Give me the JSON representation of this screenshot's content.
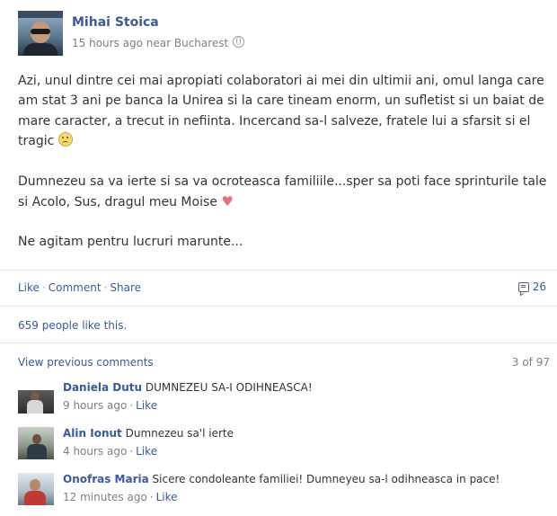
{
  "post": {
    "author": "Mihai Stoica",
    "timestamp": "15 hours ago near Bucharest",
    "privacy_icon": "globe-icon",
    "paragraphs": {
      "p1": "Azi, unul dintre cei mai apropiati colaboratori ai mei din ultimii ani, omul langa care am stat 3 ani pe banca la Unirea si la care tineam enorm, un sufletist si un baiat de mare caracter, a trecut in nefiinta. Incercand sa-l salveze, fratele lui a sfarsit si el tragic",
      "p2": "Dumnezeu sa va ierte si sa va ocroteasca familiile...sper sa poti face sprinturile tale si Acolo, Sus, dragul meu Moise",
      "p3": "Ne agitam pentru lucruri marunte..."
    },
    "emoji_sad": "sad-face-emoji",
    "emoji_heart": "♥"
  },
  "actions": {
    "like": "Like",
    "comment": "Comment",
    "share": "Share",
    "separator": "·",
    "comment_count": "26",
    "comment_count_icon": "comment-icon"
  },
  "likes": {
    "text": "659 people like this."
  },
  "comments_section": {
    "view_previous": "View previous comments",
    "pager": "3 of 97",
    "items": [
      {
        "name": "Daniela Dutu",
        "text": "DUMNEZEU SA-I ODIHNEASCA!",
        "time": "9 hours ago",
        "like": "Like"
      },
      {
        "name": "Alin Ionut",
        "text": "Dumnezeu sa'l ierte",
        "time": "4 hours ago",
        "like": "Like"
      },
      {
        "name": "Onofras Maria",
        "text": "Sicere condoleante familiei! Dumneyeu sa-l odihneasca in pace!",
        "time": "12 minutes ago",
        "like": "Like"
      }
    ]
  },
  "colors": {
    "link": "#3b5998",
    "text": "#333333",
    "muted": "#7f7f7f",
    "divider": "#e5e5e5"
  }
}
